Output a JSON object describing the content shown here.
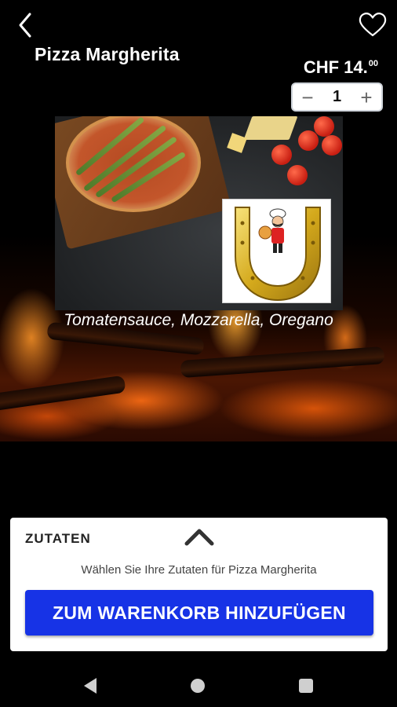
{
  "product": {
    "name": "Pizza Margherita",
    "price_main": "CHF 14.",
    "price_cents": "00",
    "quantity": "1",
    "description": "Tomatensauce, Mozzarella, Oregano"
  },
  "stepper": {
    "decrement": "−",
    "increment": "+"
  },
  "panel": {
    "title": "ZUTATEN",
    "subtitle": "Wählen Sie Ihre Zutaten für Pizza Margherita",
    "cart_button": "ZUM WARENKORB HINZUFÜGEN"
  },
  "icons": {
    "back": "back-arrow-icon",
    "favorite": "heart-outline-icon",
    "expand": "chevron-up-icon",
    "nav_back": "triangle-back-icon",
    "nav_home": "circle-home-icon",
    "nav_recent": "square-recent-icon"
  },
  "colors": {
    "cart_button": "#1733e6",
    "background": "#000000"
  }
}
